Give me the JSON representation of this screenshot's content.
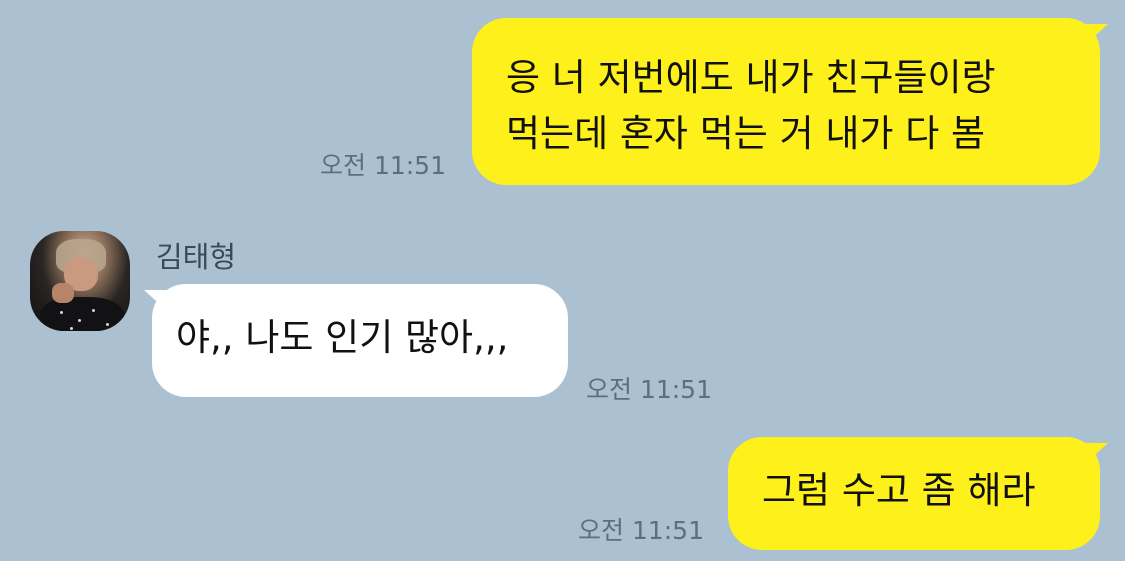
{
  "messages": [
    {
      "direction": "outgoing",
      "lines": [
        "응 너 저번에도 내가 친구들이랑",
        "먹는데 혼자 먹는 거 내가 다 봄"
      ],
      "time": "오전 11:51"
    },
    {
      "direction": "incoming",
      "sender": "김태형",
      "text": "야,, 나도 인기 많아,,,",
      "time": "오전 11:51"
    },
    {
      "direction": "outgoing",
      "text": "그럼 수고 좀 해라",
      "time": "오전 11:51"
    }
  ],
  "colors": {
    "background": "#abc1d1",
    "outgoing_bubble": "#fef01b",
    "incoming_bubble": "#ffffff",
    "time_text": "#5f6e7a"
  },
  "icons": {
    "avatar": "profile-photo"
  }
}
